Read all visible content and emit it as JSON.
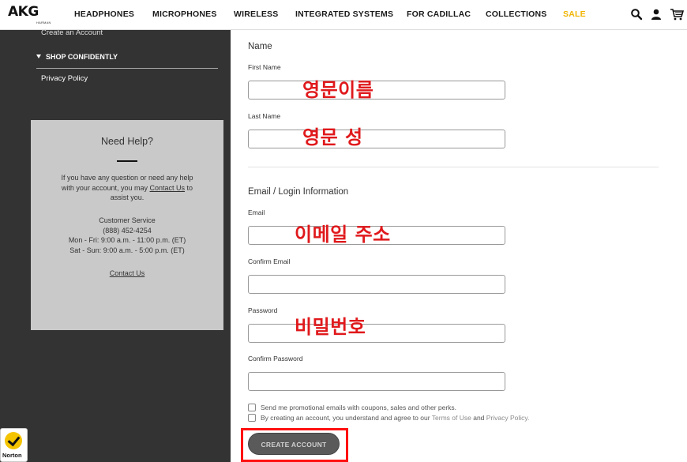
{
  "header": {
    "logo": "AKG",
    "logo_sub": "HARMAN",
    "nav": [
      {
        "label": "HEADPHONES"
      },
      {
        "label": "MICROPHONES"
      },
      {
        "label": "WIRELESS"
      },
      {
        "label": "INTEGRATED SYSTEMS"
      },
      {
        "label": "FOR CADILLAC"
      },
      {
        "label": "COLLECTIONS"
      },
      {
        "label": "SALE"
      }
    ],
    "icons": [
      "search-icon",
      "account-icon",
      "cart-icon"
    ],
    "sale_color": "#f0b400"
  },
  "sidebar": {
    "cut_link": "Create an Account",
    "shop_confidently": "SHOP CONFIDENTLY",
    "privacy_policy": "Privacy Policy",
    "help": {
      "title": "Need Help?",
      "text_before": "If you have any question or need any help with your account, you may",
      "contact_inline": "Contact Us",
      "text_after": "to assist you.",
      "cs_title": "Customer Service",
      "phone": "(888) 452-4254",
      "hours_weekday": "Mon - Fri: 9:00 a.m. - 11:00 p.m. (ET)",
      "hours_weekend": "Sat - Sun: 9:00 a.m. - 5:00 p.m. (ET)",
      "contact_link": "Contact Us"
    },
    "norton_label": "Norton"
  },
  "form": {
    "name_section": "Name",
    "first_name_label": "First Name",
    "last_name_label": "Last Name",
    "login_section": "Email / Login Information",
    "email_label": "Email",
    "confirm_email_label": "Confirm Email",
    "password_label": "Password",
    "confirm_password_label": "Confirm Password",
    "promo_text": "Send me promotional emails with coupons, sales and other perks.",
    "terms_before": "By creating an account, you understand and agree to our",
    "terms_link": "Terms of Use",
    "terms_and": "and",
    "privacy_link": "Privacy Policy.",
    "create_button": "CREATE ACCOUNT"
  },
  "annotations": {
    "first_name": "영문이름",
    "last_name": "영문 성",
    "email": "이메일 주소",
    "password": "비밀번호",
    "color": "#e0191c"
  }
}
